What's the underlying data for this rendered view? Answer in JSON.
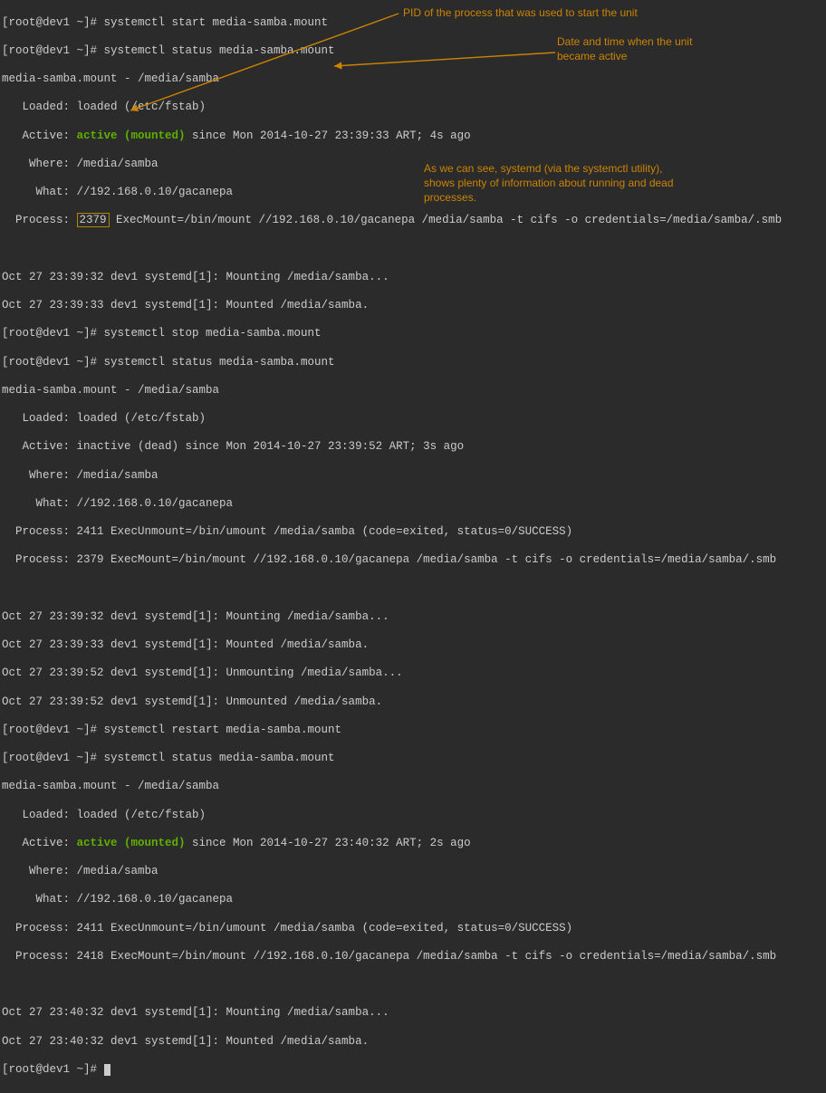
{
  "annotations": {
    "ann_pid": "PID of the process that was used to start the unit",
    "ann_date": "Date and time when the unit\nbecame active",
    "ann_note": "As we can see, systemd (via the systemctl utility),\nshows plenty of information about running and dead\nprocesses."
  },
  "t": {
    "p1": "[root@dev1 ~]# systemctl start media-samba.mount",
    "p2": "[root@dev1 ~]# systemctl status media-samba.mount",
    "s1_title": "media-samba.mount - /media/samba",
    "s1_loaded": "   Loaded: loaded (/etc/fstab)",
    "s1_active_pre": "   Active: ",
    "s1_active_state": "active (mounted)",
    "s1_active_post": " since Mon 2014-10-27 23:39:33 ART; 4s ago",
    "s1_where": "    Where: /media/samba",
    "s1_what": "     What: //192.168.0.10/gacanepa",
    "s1_process_pre": "  Process: ",
    "s1_process_pid": "2379",
    "s1_process_post": " ExecMount=/bin/mount //192.168.0.10/gacanepa /media/samba -t cifs -o credentials=/media/samba/.smb",
    "log1a": "Oct 27 23:39:32 dev1 systemd[1]: Mounting /media/samba...",
    "log1b": "Oct 27 23:39:33 dev1 systemd[1]: Mounted /media/samba.",
    "p3": "[root@dev1 ~]# systemctl stop media-samba.mount",
    "p4": "[root@dev1 ~]# systemctl status media-samba.mount",
    "s2_title": "media-samba.mount - /media/samba",
    "s2_loaded": "   Loaded: loaded (/etc/fstab)",
    "s2_active": "   Active: inactive (dead) since Mon 2014-10-27 23:39:52 ART; 3s ago",
    "s2_where": "    Where: /media/samba",
    "s2_what": "     What: //192.168.0.10/gacanepa",
    "s2_proc1": "  Process: 2411 ExecUnmount=/bin/umount /media/samba (code=exited, status=0/SUCCESS)",
    "s2_proc2": "  Process: 2379 ExecMount=/bin/mount //192.168.0.10/gacanepa /media/samba -t cifs -o credentials=/media/samba/.smb",
    "log2a": "Oct 27 23:39:32 dev1 systemd[1]: Mounting /media/samba...",
    "log2b": "Oct 27 23:39:33 dev1 systemd[1]: Mounted /media/samba.",
    "log2c": "Oct 27 23:39:52 dev1 systemd[1]: Unmounting /media/samba...",
    "log2d": "Oct 27 23:39:52 dev1 systemd[1]: Unmounted /media/samba.",
    "p5": "[root@dev1 ~]# systemctl restart media-samba.mount",
    "p6": "[root@dev1 ~]# systemctl status media-samba.mount",
    "s3_title": "media-samba.mount - /media/samba",
    "s3_loaded": "   Loaded: loaded (/etc/fstab)",
    "s3_active_pre": "   Active: ",
    "s3_active_state": "active (mounted)",
    "s3_active_post": " since Mon 2014-10-27 23:40:32 ART; 2s ago",
    "s3_where": "    Where: /media/samba",
    "s3_what": "     What: //192.168.0.10/gacanepa",
    "s3_proc1": "  Process: 2411 ExecUnmount=/bin/umount /media/samba (code=exited, status=0/SUCCESS)",
    "s3_proc2": "  Process: 2418 ExecMount=/bin/mount //192.168.0.10/gacanepa /media/samba -t cifs -o credentials=/media/samba/.smb",
    "log3a": "Oct 27 23:40:32 dev1 systemd[1]: Mounting /media/samba...",
    "log3b": "Oct 27 23:40:32 dev1 systemd[1]: Mounted /media/samba.",
    "p7": "[root@dev1 ~]# "
  }
}
